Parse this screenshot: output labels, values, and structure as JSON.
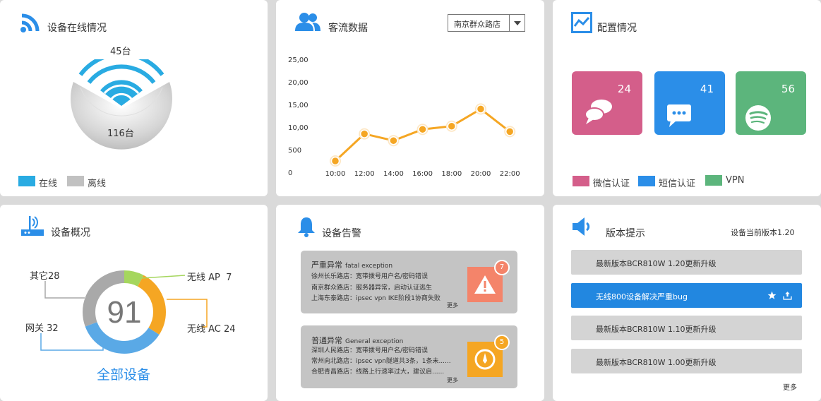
{
  "devices_online": {
    "title": "设备在线情况",
    "online_count": "45台",
    "offline_count": "116台",
    "legend": [
      {
        "label": "在线",
        "color": "#29abe2"
      },
      {
        "label": "离线",
        "color": "#c1c1c1"
      }
    ]
  },
  "traffic": {
    "title": "客流数据",
    "store_select": "南京群众路店"
  },
  "chart_data": {
    "type": "line",
    "x": [
      "10:00",
      "12:00",
      "14:00",
      "16:00",
      "18:00",
      "20:00",
      "22:00"
    ],
    "values": [
      2.5,
      8.5,
      7.0,
      9.5,
      10.2,
      14.0,
      9.0
    ],
    "y_tick_labels": [
      "0",
      "500",
      "10,00",
      "15,00",
      "20,00",
      "25,00"
    ],
    "ylim": [
      0,
      25
    ],
    "color": "#f5a623",
    "grid": false
  },
  "config": {
    "title": "配置情况",
    "tiles": [
      {
        "count": "24",
        "color": "#d45e8a",
        "icon": "wechat-chat-icon"
      },
      {
        "count": "41",
        "color": "#2b8ee8",
        "icon": "sms-message-icon"
      },
      {
        "count": "56",
        "color": "#5cb57c",
        "icon": "spotify-vpn-icon"
      }
    ],
    "legend": [
      {
        "label": "微信认证",
        "color": "#d45e8a"
      },
      {
        "label": "短信认证",
        "color": "#2b8ee8"
      },
      {
        "label": "VPN",
        "color": "#5cb57c"
      }
    ]
  },
  "overview": {
    "title": "设备概况",
    "total": "91",
    "subtitle": "全部设备",
    "segments": [
      {
        "label": "无线 AP  7",
        "value": 7,
        "color": "#a5d65e"
      },
      {
        "label": "无线 AC 24",
        "value": 24,
        "color": "#f5a623"
      },
      {
        "label": "网关 32",
        "value": 32,
        "color": "#5aa9e6"
      },
      {
        "label": "其它28",
        "value": 28,
        "color": "#a9a9a9"
      }
    ]
  },
  "alarms": {
    "title": "设备告警",
    "items": [
      {
        "title": "严重异常",
        "title_en": "fatal exception",
        "lines": [
          "徐州长乐路店：宽带拨号用户名/密码错误",
          "南京群众路店：服务器异常，启动认证逃生",
          "上海东泰路店：ipsec vpn IKE阶段1协商失败"
        ],
        "more": "更多",
        "badge": "7",
        "color": "#f4846a",
        "icon": "warning-icon"
      },
      {
        "title": "普通异常",
        "title_en": "General exception",
        "lines": [
          "深圳人民路店：宽带拨号用户名/密码错误",
          "常州向北路店：ipsec vpn隧道共3条，1条未......",
          "合肥青昌路店：线路上行速率过大，建议启......"
        ],
        "more": "更多",
        "badge": "5",
        "color": "#f5a623",
        "icon": "compass-icon"
      }
    ]
  },
  "version": {
    "title": "版本提示",
    "current": "设备当前版本1.20",
    "items": [
      {
        "label": "最新版本BCR810W 1.20更新升级",
        "active": false
      },
      {
        "label": "无线800设备解决严重bug",
        "active": true
      },
      {
        "label": "最新版本BCR810W 1.10更新升级",
        "active": false
      },
      {
        "label": "最新版本BCR810W 1.00更新升级",
        "active": false
      }
    ],
    "more": "更多"
  }
}
